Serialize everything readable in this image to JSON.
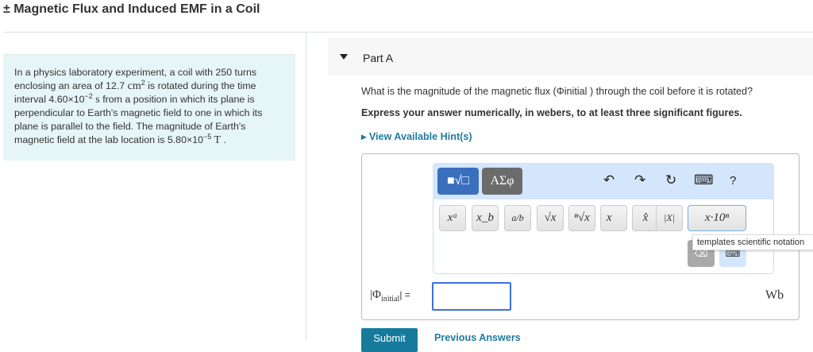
{
  "title": "± Magnetic Flux and Induced EMF in a Coil",
  "problem": {
    "t1": "In a physics laboratory experiment, a coil with 250 turns enclosing an area of 12.7 ",
    "u1": "cm",
    "e1": "2",
    "t2": " is rotated during the time interval 4.60×10",
    "e2": "−2",
    "u2": " s",
    "t3": " from a position in which its plane is perpendicular to Earth's magnetic field to one in which its plane is parallel to the field. The magnitude of Earth's magnetic field at the lab location is 5.80×10",
    "e3": "−5",
    "u3": " T",
    "t4": " ."
  },
  "part": {
    "label": "Part A",
    "question": "What is the magnitude of the magnetic flux (Φinitial ) through the coil before it is rotated?",
    "instructions": "Express your answer numerically, in webers, to at least three significant figures.",
    "hint": "View Available Hint(s)"
  },
  "toolbar": {
    "templates": "■√□",
    "greek": "ΑΣφ",
    "undo": "↶",
    "redo": "↷",
    "reset": "↻",
    "keyboard": "⌨",
    "help": "?",
    "buttons": [
      "xᵃ",
      "x_b",
      "a/b",
      "√x",
      "ⁿ√x",
      "x⃗",
      "x̂",
      "|X|"
    ],
    "sci": "x·10ⁿ",
    "backspace": "⌫",
    "keyboard2": "⌨",
    "tooltip": "templates scientific notation"
  },
  "answer": {
    "label_sym": "|Φ",
    "label_sub": "initial",
    "label_end": "| =",
    "value": "",
    "unit": "Wb"
  },
  "actions": {
    "submit": "Submit",
    "previous": "Previous Answers"
  }
}
